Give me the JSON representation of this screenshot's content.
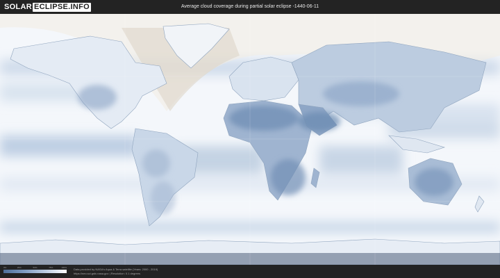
{
  "header": {
    "logo_left": "SOLAR",
    "logo_right": "ECLIPSE.INFO",
    "title": "Average cloud coverage during partial solar eclipse -1440-06-11"
  },
  "legend": {
    "ticks": [
      "0%",
      "25%",
      "50%",
      "75%",
      "100%"
    ],
    "tick_fractions": [
      0,
      0.25,
      0.5,
      0.75,
      1
    ],
    "gradient_colors": [
      "#4f6f9a",
      "#7f9cc2",
      "#bccde2",
      "#ffffff"
    ]
  },
  "footer": {
    "credit_line_1": "Data provided by NASA's Aqua & Terra satellite (Years: 2000 - 2019)",
    "credit_line_2": "https://neo.sci.gsfc.nasa.gov | Resolution: 0.1 degrees"
  },
  "map": {
    "projection": "equirectangular",
    "colors": {
      "clear": "#ffffff",
      "cloud_light": "#dfe7f1",
      "cloud_mid": "#a9bdd6",
      "cloud_dense": "#5f7ea6",
      "land_outline": "#8ea3bd",
      "eclipse_shadow": "#c9c2b4",
      "antarctic_shade": "#cfd9e6"
    }
  }
}
